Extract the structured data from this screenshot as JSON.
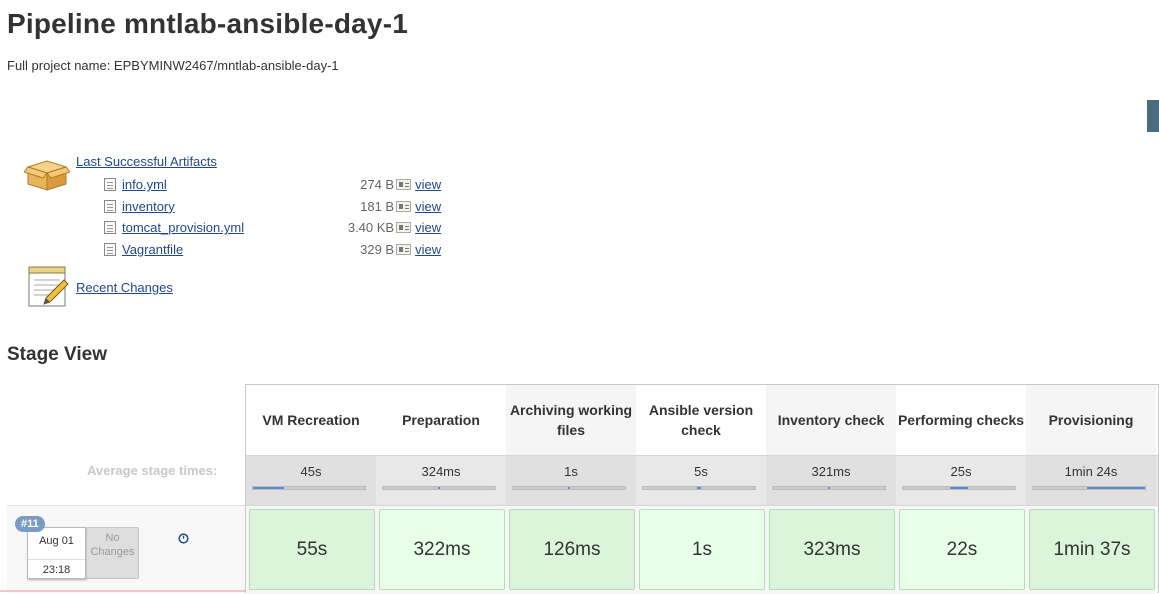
{
  "page": {
    "title": "Pipeline mntlab-ansible-day-1",
    "full_name": "Full project name: EPBYMINW2467/mntlab-ansible-day-1"
  },
  "artifacts": {
    "label": "Last Successful Artifacts",
    "icon": "package-box-icon",
    "files": [
      {
        "name": "info.yml",
        "size": "274 B",
        "view": "view"
      },
      {
        "name": "inventory",
        "size": "181 B",
        "view": "view"
      },
      {
        "name": "tomcat_provision.yml",
        "size": "3.40 KB",
        "view": "view"
      },
      {
        "name": "Vagrantfile",
        "size": "329 B",
        "view": "view"
      }
    ]
  },
  "recent_changes": {
    "label": "Recent Changes",
    "icon": "notepad-icon"
  },
  "stage_view": {
    "title": "Stage View",
    "avg_label": "Average stage times:",
    "stages": [
      {
        "name": "VM Recreation",
        "avg": "45s",
        "avg_fraction": 0.28,
        "run": "55s",
        "shade": "dark"
      },
      {
        "name": "Preparation",
        "avg": "324ms",
        "avg_fraction": 0.01,
        "run": "322ms",
        "shade": "light"
      },
      {
        "name": "Archiving working files",
        "avg": "1s",
        "avg_fraction": 0.02,
        "run": "126ms",
        "shade": "dark"
      },
      {
        "name": "Ansible version check",
        "avg": "5s",
        "avg_fraction": 0.04,
        "run": "1s",
        "shade": "light"
      },
      {
        "name": "Inventory check",
        "avg": "321ms",
        "avg_fraction": 0.01,
        "run": "323ms",
        "shade": "dark"
      },
      {
        "name": "Performing checks",
        "avg": "25s",
        "avg_fraction": 0.16,
        "run": "22s",
        "shade": "light"
      },
      {
        "name": "Provisioning",
        "avg": "1min 24s",
        "avg_fraction": 0.52,
        "run": "1min 37s",
        "shade": "dark"
      }
    ],
    "build": {
      "number": "#11",
      "date": "Aug 01",
      "time": "23:18",
      "changes": "No Changes"
    }
  },
  "colors": {
    "accent_link": "#204a87",
    "success_dark": "#daf5da",
    "success_light": "#e8ffe8",
    "bar_fill": "#5b8ed6",
    "build_pill": "#7a9cc4"
  }
}
